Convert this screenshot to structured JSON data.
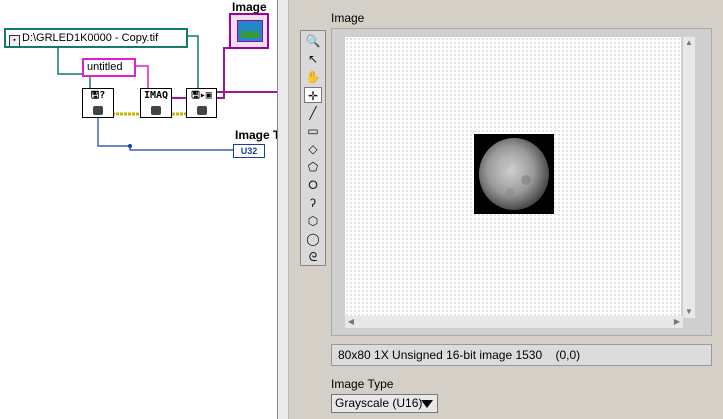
{
  "block_diagram": {
    "path_constant": "D:\\GRLED1K0000 - Copy.tif",
    "image_name_constant": "untitled",
    "vi_nodes": [
      {
        "id": "file-info",
        "glyph": "🖫?"
      },
      {
        "id": "imaq-create",
        "glyph": "IMAQ"
      },
      {
        "id": "read-file",
        "glyph": "🖫▸▣"
      }
    ],
    "image_indicator_label": "Image",
    "image_type_indicator_label": "Image T",
    "image_type_indicator_datatype": "U32"
  },
  "front_panel": {
    "image_display_label": "Image",
    "tools": [
      "🔍",
      "↖",
      "✋",
      "✛",
      "╱",
      "▭",
      "◇",
      "⬠",
      "⭘",
      "ʔ",
      "⬡",
      "◯",
      "ᘓ"
    ],
    "selected_tool_index": 3,
    "image_info": "80x80 1X Unsigned 16-bit image 1530",
    "cursor_coords": "(0,0)",
    "image_type_label": "Image Type",
    "image_type_value": "Grayscale (U16)"
  },
  "colors": {
    "path_wire": "#147a6e",
    "string_wire": "#e020d0",
    "image_wire": "#9a1a9a",
    "numeric_wire": "#1a3fa0",
    "error_wire": "#c8b400"
  }
}
